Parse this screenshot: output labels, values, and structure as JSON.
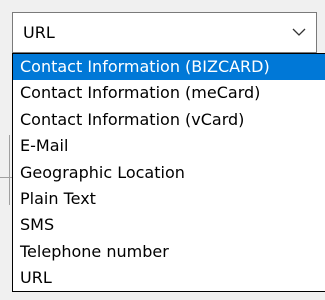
{
  "select": {
    "value": "URL",
    "icon": "chevron-down-icon"
  },
  "dropdown": {
    "selected_index": 0,
    "options": [
      "Contact Information (BIZCARD)",
      "Contact Information (meCard)",
      "Contact Information (vCard)",
      "E-Mail",
      "Geographic Location",
      "Plain Text",
      "SMS",
      "Telephone number",
      "URL"
    ]
  },
  "colors": {
    "highlight_bg": "#0078d7",
    "highlight_fg": "#ffffff"
  }
}
